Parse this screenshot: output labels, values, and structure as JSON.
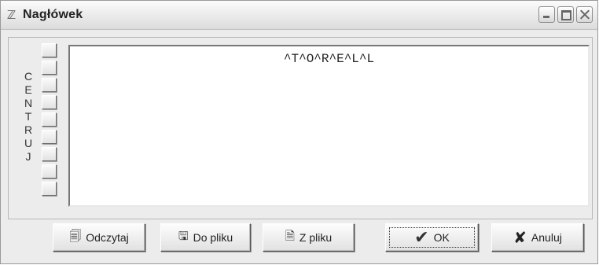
{
  "window": {
    "title": "Nagłówek",
    "controls": {
      "minimize": "minimize-icon",
      "maximize": "maximize-icon",
      "close": "close-icon"
    }
  },
  "align_labels": [
    "C",
    "E",
    "N",
    "T",
    "R",
    "U",
    "J"
  ],
  "editor": {
    "text": "^T^O^R^E^L^L"
  },
  "buttons": {
    "read": {
      "label": "Odczytaj",
      "icon": "read-icon"
    },
    "save": {
      "label": "Do pliku",
      "icon": "save-to-file-icon"
    },
    "load": {
      "label": "Z pliku",
      "icon": "load-from-file-icon"
    },
    "ok": {
      "label": "OK",
      "icon": "checkmark-icon"
    },
    "cancel": {
      "label": "Anuluj",
      "icon": "x-icon"
    }
  }
}
